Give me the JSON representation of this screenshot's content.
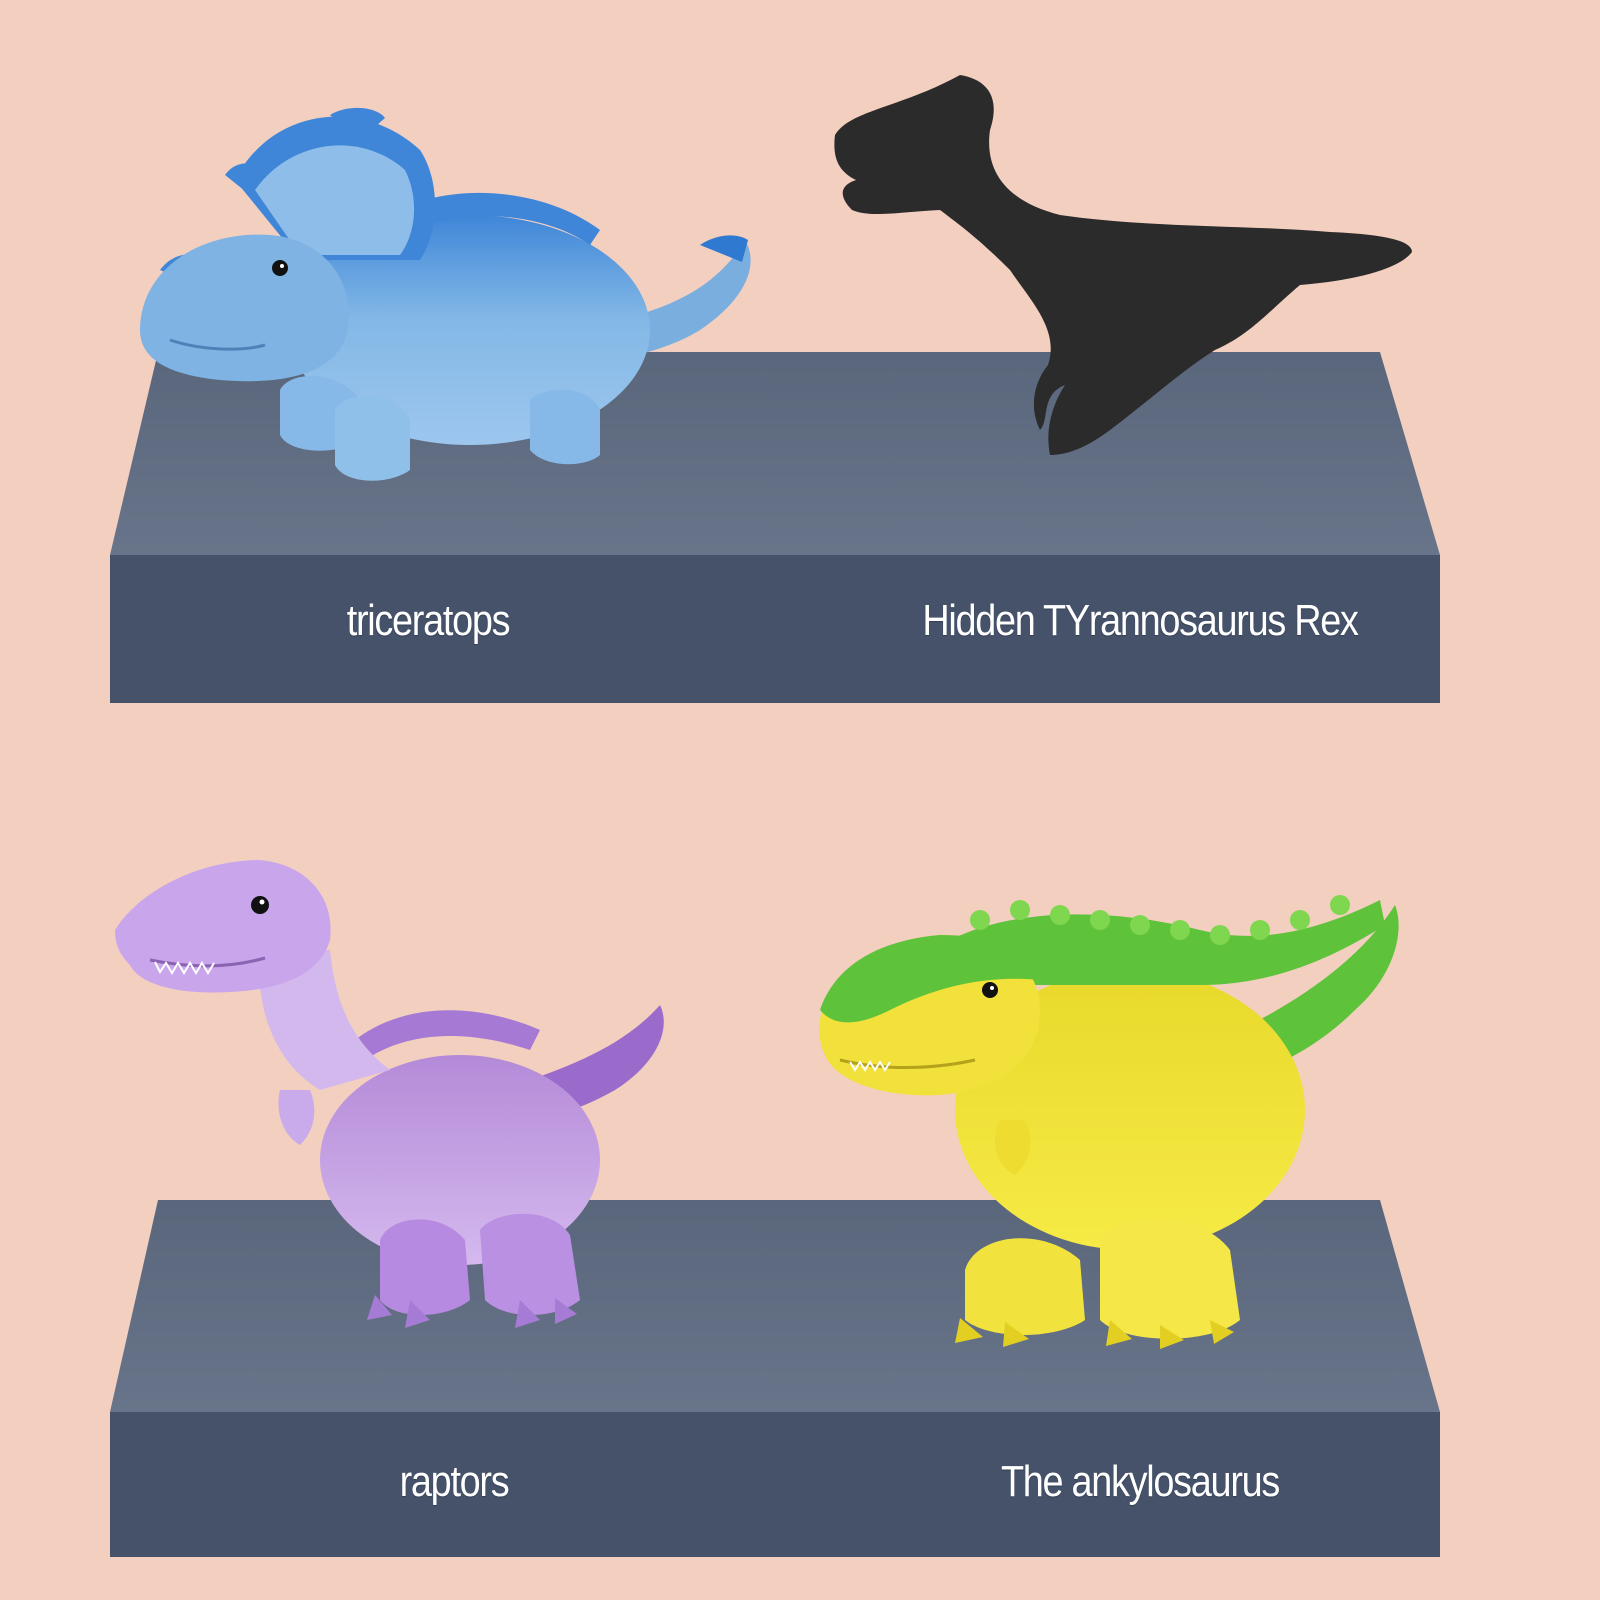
{
  "colors": {
    "background": "#f3cfc0",
    "shelf_top": "#5f6b80",
    "shelf_front": "#45526a",
    "label_text": "#ffffff",
    "triceratops": "#7fb3e0",
    "trex_silhouette": "#2b2b2b",
    "raptor": "#c6a0e6",
    "ankylosaurus": "#f1e13a",
    "ankylosaurus_spikes": "#5fc23b"
  },
  "shelves": [
    {
      "figures": [
        {
          "name": "triceratops",
          "icon": "triceratops-figure"
        },
        {
          "name": "Hidden TYrannosaurus Rex",
          "icon": "trex-silhouette"
        }
      ]
    },
    {
      "figures": [
        {
          "name": "raptors",
          "icon": "raptor-figure"
        },
        {
          "name": "The ankylosaurus",
          "icon": "ankylosaurus-figure"
        }
      ]
    }
  ]
}
